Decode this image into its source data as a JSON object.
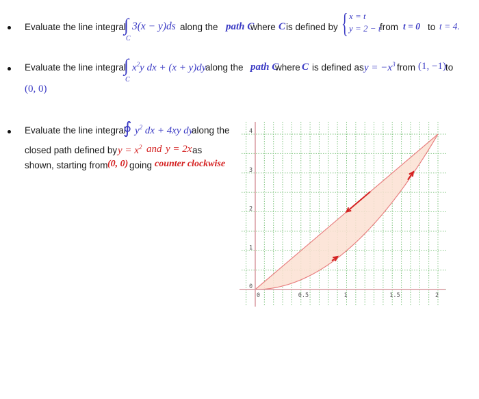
{
  "problems": [
    {
      "bullet": "•",
      "prefix": "Evaluate the line integral",
      "integral_sign": "∫",
      "integral_sub": "C",
      "integrand": "3(x − y)ds",
      "mid1": "along the",
      "path_label": "path C",
      "mid2": "where",
      "c_label": "C",
      "mid3": "is defined by",
      "system_line1": "x = t",
      "system_line2": "y = 2 − t",
      "from_word": "from",
      "t_start": "t = 0",
      "to_word": "to",
      "t_end": "t = 4."
    },
    {
      "bullet": "•",
      "prefix": "Evaluate the line integral",
      "integral_sign": "∫",
      "integral_sub": "C",
      "integrand_html": "x²y dx + (x + y)dy",
      "mid1": "along the",
      "path_label": "path C",
      "mid2": "where",
      "c_label": "C",
      "mid3": "is defined as",
      "curve": "y = −x³",
      "from_word": "from",
      "start_point": "(1, −1)",
      "to_word": "to",
      "end_point": "(0, 0)"
    },
    {
      "bullet": "•",
      "prefix": "Evaluate the line integral",
      "integral_sign": "∮",
      "integrand": "y² dx + 4xy dy",
      "suffix": "along the",
      "line2_prefix": "closed path defined by",
      "curve1": "y = x²",
      "and_word": "and",
      "curve2": "y = 2x",
      "as_word": "as",
      "line3_prefix": "shown, starting from",
      "start_point": "(0, 0)",
      "going_word": "going",
      "direction": "counter clockwise"
    }
  ],
  "graph": {
    "x_ticks": [
      "0",
      "0.5",
      "1",
      "1.5",
      "2"
    ],
    "y_ticks": [
      "0",
      "1",
      "2",
      "3",
      "4"
    ],
    "x_range": [
      0,
      2
    ],
    "y_range": [
      0,
      4
    ],
    "curves": [
      "y = x^2",
      "y = 2x"
    ],
    "region_color": "#fbe0d2",
    "curve_color": "#e88080",
    "arrow_color": "#d42020",
    "grid_color": "#7fc47f",
    "axis_color": "#d89aa0",
    "arrows": [
      {
        "on": "y = x^2",
        "at_x": 0.9,
        "direction": "up-right"
      },
      {
        "on": "y = x^2",
        "at_x": 1.73,
        "direction": "up-right"
      },
      {
        "on": "y = 2x",
        "at_x": 1.0,
        "direction": "down-left"
      }
    ]
  }
}
